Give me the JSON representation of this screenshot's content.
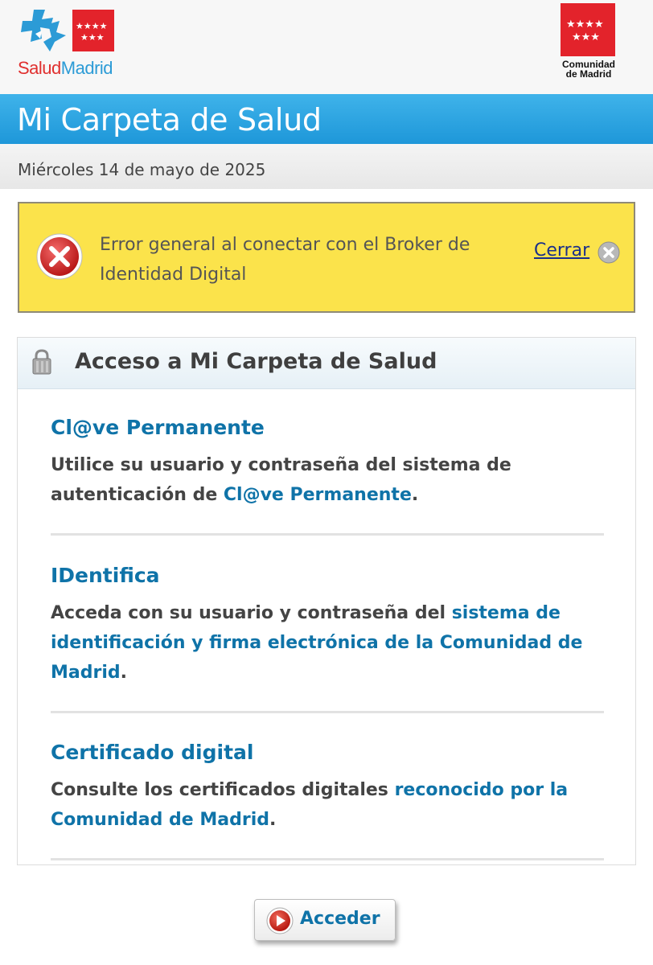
{
  "header": {
    "salud_logo": {
      "part1": "Salud",
      "part2": "Madrid"
    },
    "cm_logo": {
      "line1": "Comunidad",
      "line2": "de Madrid"
    }
  },
  "title_bar": {
    "title": "Mi Carpeta de Salud"
  },
  "date_bar": {
    "date": "Miércoles 14 de mayo de 2025"
  },
  "error": {
    "message": "Error general al conectar con el Broker de Identidad Digital",
    "close_label": "Cerrar"
  },
  "panel": {
    "title": "Acceso a Mi Carpeta de Salud",
    "options": [
      {
        "title": "Cl@ve Permanente",
        "desc_plain": "Utilice su usuario y contraseña del sistema de autenticación de ",
        "desc_link": "Cl@ve Permanente",
        "desc_end": "."
      },
      {
        "title": "IDentifica",
        "desc_plain": "Acceda con su usuario y contraseña del ",
        "desc_link": "sistema de identificación y firma electrónica de la Comunidad de Madrid",
        "desc_end": "."
      },
      {
        "title": "Certificado digital",
        "desc_plain": "Consulte los certificados digitales ",
        "desc_link": "reconocido por la Comunidad de Madrid",
        "desc_end": "."
      }
    ]
  },
  "button": {
    "label": "Acceder"
  },
  "colors": {
    "title_bar": "#1e97d9",
    "error_bg": "#fbe34b",
    "link": "#0f73a8",
    "madrid_red": "#e3232b"
  },
  "icons": [
    "salud-madrid-cross-icon",
    "madrid-stars-icon",
    "error-x-icon",
    "close-circle-icon",
    "lock-icon",
    "play-icon"
  ]
}
